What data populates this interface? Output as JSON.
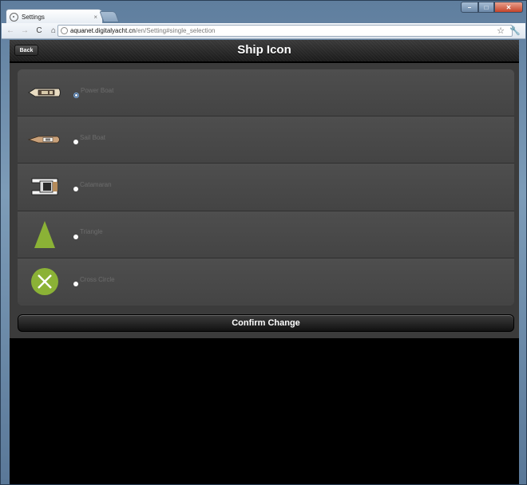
{
  "browser": {
    "tab_title": "Settings",
    "tab_close": "×",
    "url_host": "aquanet.digitalyacht.cn",
    "url_path": "/en/Setting#single_selection"
  },
  "header": {
    "back_label": "Back",
    "title": "Ship Icon"
  },
  "options": [
    {
      "label": "Power Boat",
      "icon": "power-boat-icon",
      "selected": true
    },
    {
      "label": "Sail Boat",
      "icon": "sail-boat-icon",
      "selected": false
    },
    {
      "label": "Catamaran",
      "icon": "catamaran-icon",
      "selected": false
    },
    {
      "label": "Triangle",
      "icon": "triangle-icon",
      "selected": false
    },
    {
      "label": "Cross Circle",
      "icon": "cross-circle-icon",
      "selected": false
    }
  ],
  "confirm_label": "Confirm Change",
  "colors": {
    "icon_green": "#8bb236",
    "list_bg": "#494949",
    "page_bg": "#000000"
  }
}
